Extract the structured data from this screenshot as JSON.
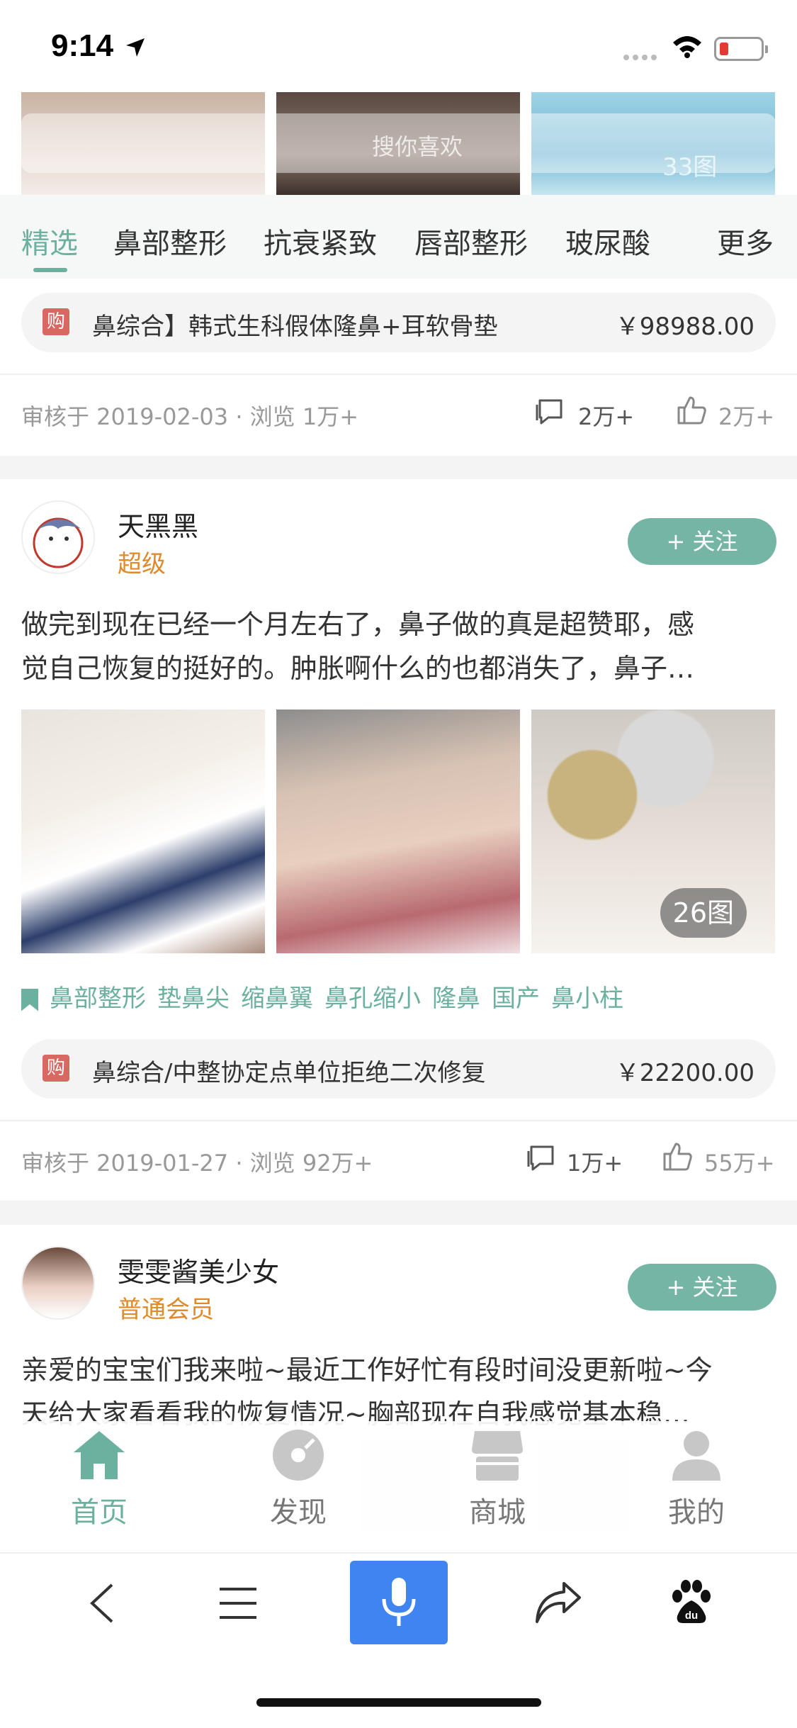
{
  "status": {
    "time": "9:14"
  },
  "top_images": {
    "search_placeholder": "搜你喜欢",
    "count": "33图"
  },
  "tabs": [
    {
      "label": "精选",
      "active": true
    },
    {
      "label": "鼻部整形"
    },
    {
      "label": "抗衰紧致"
    },
    {
      "label": "唇部整形"
    },
    {
      "label": "玻尿酸"
    },
    {
      "label": "更多"
    }
  ],
  "card1": {
    "buy_badge": "购",
    "product": "鼻综合】韩式生科假体隆鼻+耳软骨垫",
    "price": "￥98988.00",
    "meta": "审核于 2019-02-03 · 浏览 1万+",
    "comments": "2万+",
    "likes": "2万+"
  },
  "post2": {
    "user": "天黑黑",
    "level": "超级",
    "follow": "+ 关注",
    "text_line1": "做完到现在已经一个月左右了，鼻子做的真是超赞耶，感",
    "text_line2": "觉自己恢复的挺好的。肿胀啊什么的也都消失了，鼻子…",
    "image_count": "26图",
    "tags": [
      "鼻部整形",
      "垫鼻尖",
      "缩鼻翼",
      "鼻孔缩小",
      "隆鼻",
      "国产",
      "鼻小柱"
    ],
    "buy_badge": "购",
    "product": "鼻综合/中整协定点单位拒绝二次修复",
    "price": "￥22200.00",
    "meta": "审核于 2019-01-27 · 浏览 92万+",
    "comments": "1万+",
    "likes": "55万+"
  },
  "post3": {
    "user": "雯雯酱美少女",
    "level": "普通会员",
    "follow": "+ 关注",
    "text_line1": "亲爱的宝宝们我来啦~最近工作好忙有段时间没更新啦~今",
    "text_line2": "天给大家看看我的恢复情况~胸部现在自我感觉基本稳…"
  },
  "tabbar": [
    {
      "label": "首页",
      "icon": "home-icon",
      "active": true
    },
    {
      "label": "发现",
      "icon": "discover-icon"
    },
    {
      "label": "商城",
      "icon": "shop-icon"
    },
    {
      "label": "我的",
      "icon": "profile-icon"
    }
  ],
  "browser": {
    "icons": [
      "back-icon",
      "menu-icon",
      "mic-icon",
      "share-icon",
      "baidu-icon"
    ]
  },
  "colors": {
    "accent": "#6cb0a0",
    "level_orange": "#e08a2a",
    "buy_red": "#d96863",
    "mic_blue": "#3f84f1"
  }
}
